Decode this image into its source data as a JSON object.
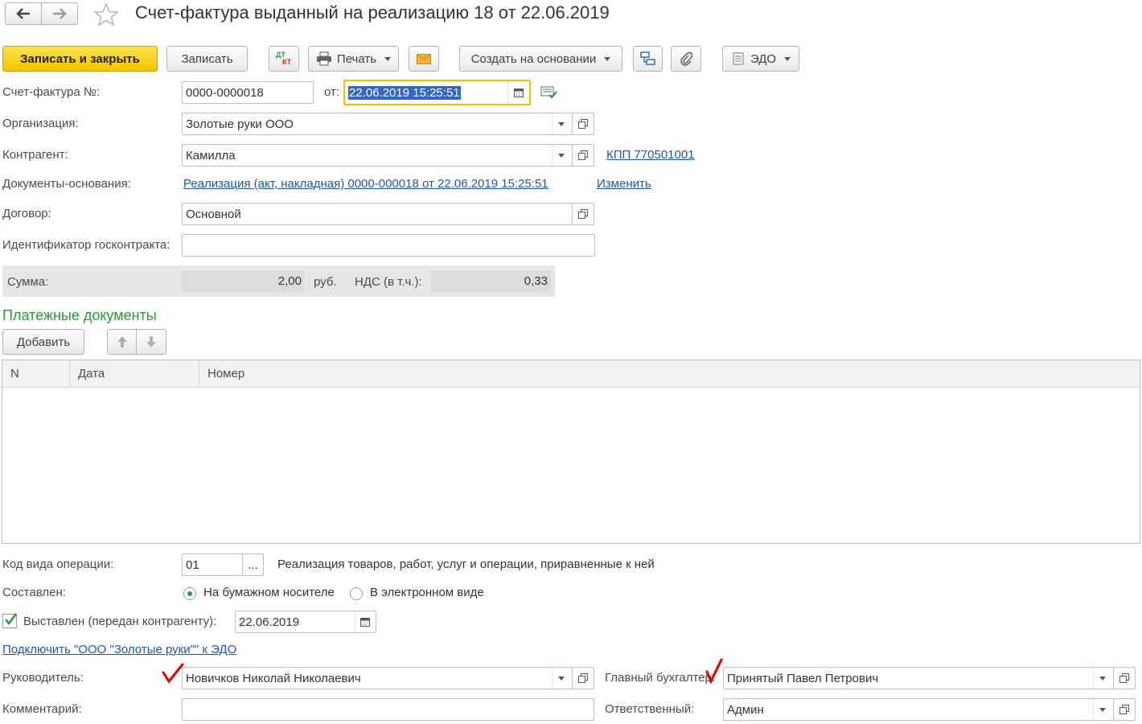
{
  "header": {
    "title": "Счет-фактура выданный на реализацию 18 от 22.06.2019"
  },
  "toolbar": {
    "save_close": "Записать и закрыть",
    "save": "Записать",
    "dtkt_top": "ДТ",
    "dtkt_bottom": "КТ",
    "print": "Печать",
    "create_based": "Создать на основании",
    "edo": "ЭДО"
  },
  "form": {
    "invoice_no_label": "Счет-фактура №:",
    "invoice_no": "0000-0000018",
    "from_label": "от:",
    "date": "22.06.2019 15:25:51",
    "org_label": "Организация:",
    "org": "Золотые руки ООО",
    "contractor_label": "Контрагент:",
    "contractor": "Камилла",
    "kpp_link": "КПП 770501001",
    "base_docs_label": "Документы-основания:",
    "base_docs_link": "Реализация (акт, накладная) 0000-000018 от 22.06.2019 15:25:51",
    "change_link": "Изменить",
    "contract_label": "Договор:",
    "contract": "Основной",
    "gov_id_label": "Идентификатор госконтракта:",
    "gov_id": ""
  },
  "sum": {
    "label": "Сумма:",
    "value": "2,00",
    "currency": "руб.",
    "vat_label": "НДС (в т.ч.):",
    "vat_value": "0,33"
  },
  "payments": {
    "title": "Платежные документы",
    "add": "Добавить",
    "columns": [
      "N",
      "Дата",
      "Номер"
    ],
    "rows": []
  },
  "bottom": {
    "op_code_label": "Код вида операции:",
    "op_code": "01",
    "op_code_btn": "...",
    "op_code_desc": "Реализация товаров, работ, услуг и операции, приравненные к ней",
    "compiled_label": "Составлен:",
    "paper": "На бумажном носителе",
    "electronic": "В электронном виде",
    "issued_label": "Выставлен (передан контрагенту):",
    "issued_date": "22.06.2019",
    "edo_link": "Подключить \"ООО \"Золотые руки\"\" к ЭДО",
    "head_label": "Руководитель:",
    "head": "Новичков Николай Николаевич",
    "chief_acc_label": "Главный бухгалтер:",
    "chief_acc": "Принятый Павел Петрович",
    "comment_label": "Комментарий:",
    "comment": "",
    "responsible_label": "Ответственный:",
    "responsible": "Админ"
  },
  "colors": {
    "accent_green": "#2b9a3e",
    "primary_yellow": "#f7d21e",
    "link_blue": "#1c55b3",
    "focus_border": "#f2c200",
    "annotation_red": "#e00000"
  }
}
